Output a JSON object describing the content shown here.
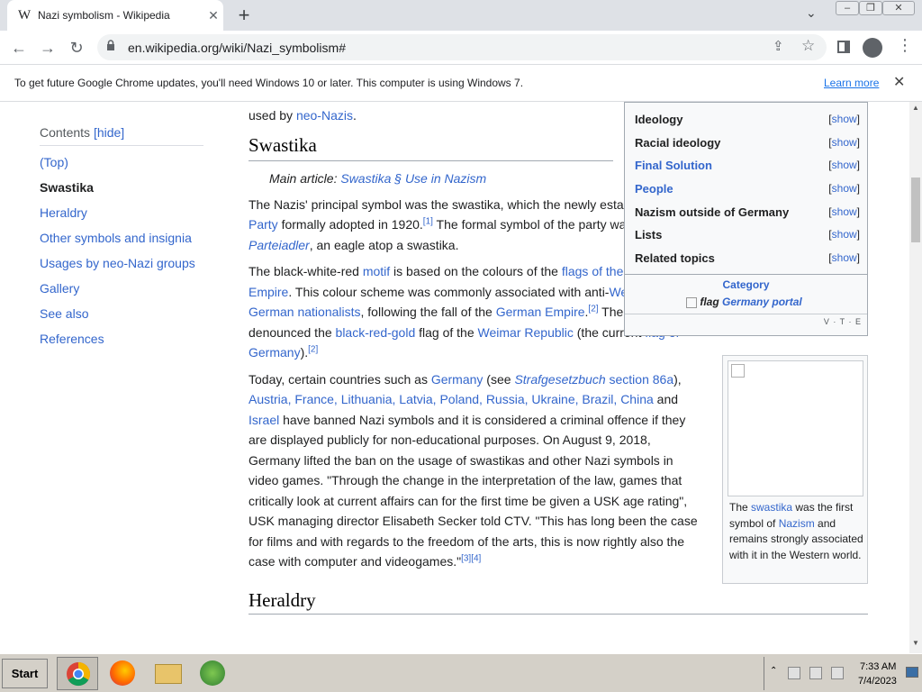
{
  "browser": {
    "tab_title": "Nazi symbolism - Wikipedia",
    "tab_logo": "W",
    "url": "en.wikipedia.org/wiki/Nazi_symbolism#",
    "new_tab": "+",
    "infobar_message": "To get future Google Chrome updates, you'll need Windows 10 or later. This computer is using Windows 7.",
    "infobar_link": "Learn more"
  },
  "toc": {
    "title": "Contents",
    "hide": "[hide]",
    "items": [
      "(Top)",
      "Swastika",
      "Heraldry",
      "Other symbols and insignia",
      "Usages by neo-Nazi groups",
      "Gallery",
      "See also",
      "References"
    ],
    "active_index": 1
  },
  "article": {
    "intro_tail": "used by ",
    "intro_link": "neo-Nazis",
    "intro_end": ".",
    "section1_title": "Swastika",
    "hatnote_prefix": "Main article: ",
    "hatnote_link": "Swastika § Use in Nazism",
    "p1": {
      "t1": "The Nazis' principal symbol was the swastika, which the newly established ",
      "l1": "Nazi Party",
      "t2": " formally adopted in 1920.",
      "r1": "[1]",
      "t3": " The formal symbol of the party was the ",
      "l2": "Parteiadler",
      "t4": ", an eagle atop a swastika."
    },
    "p2": {
      "t1": "The black-white-red ",
      "l1": "motif",
      "t2": " is based on the colours of the ",
      "l2": "flags of the German Empire",
      "t3": ". This colour scheme was commonly associated with anti-",
      "l3": "Weimar German nationalists",
      "t4": ", following the fall of the ",
      "l4": "German Empire",
      "t5": ".",
      "r1": "[2]",
      "t6": " The Nazis denounced the ",
      "l5": "black-red-gold",
      "t7": " flag of the ",
      "l6": "Weimar Republic",
      "t8": " (the current ",
      "l7": "flag of Germany",
      "t9": ").",
      "r2": "[2]"
    },
    "p3": {
      "t1": "Today, certain countries such as ",
      "l1": "Germany",
      "t2": " (see ",
      "l2": "Strafgesetzbuch",
      "t3": " ",
      "l3": "section 86a",
      "t4": "), ",
      "l4": "Austria, France, Lithuania, Latvia, Poland, Russia, Ukraine, Brazil, China",
      "t5": " and ",
      "l5": "Israel",
      "t6": " have banned Nazi symbols and it is considered a criminal offence if they are displayed publicly for non-educational purposes. On August 9, 2018, Germany lifted the ban on the usage of swastikas and other Nazi symbols in video games. \"Through the change in the interpretation of the law, games that critically look at current affairs can for the first time be given a USK age rating\", USK managing director Elisabeth Secker told CTV. \"This has long been the case for films and with regards to the freedom of the arts, this is now rightly also the case with computer and videogames.\"",
      "r1": "[3]",
      "r2": "[4]"
    },
    "section2_title": "Heraldry"
  },
  "navbox": {
    "rows": [
      {
        "label": "Ideology",
        "link": false,
        "show": "show"
      },
      {
        "label": "Racial ideology",
        "link": false,
        "show": "show"
      },
      {
        "label": "Final Solution",
        "link": true,
        "show": "show"
      },
      {
        "label": "People",
        "link": true,
        "show": "show"
      },
      {
        "label": "Nazism outside of Germany",
        "link": false,
        "show": "show"
      },
      {
        "label": "Lists",
        "link": false,
        "show": "show"
      },
      {
        "label": "Related topics",
        "link": false,
        "show": "show"
      }
    ],
    "category": "Category",
    "portal_alt": "flag",
    "portal": "Germany portal",
    "vte": "V · T · E"
  },
  "thumb": {
    "c1": "The ",
    "l1": "swastika",
    "c2": " was the first symbol of ",
    "l2": "Nazism",
    "c3": " and remains strongly associated with it in the Western world."
  },
  "taskbar": {
    "start": "Start",
    "time": "7:33 AM",
    "date": "7/4/2023"
  },
  "colors": {
    "link": "#3366cc",
    "chrome_tabstrip": "#dee1e6",
    "taskbar": "#d4d0c8"
  }
}
